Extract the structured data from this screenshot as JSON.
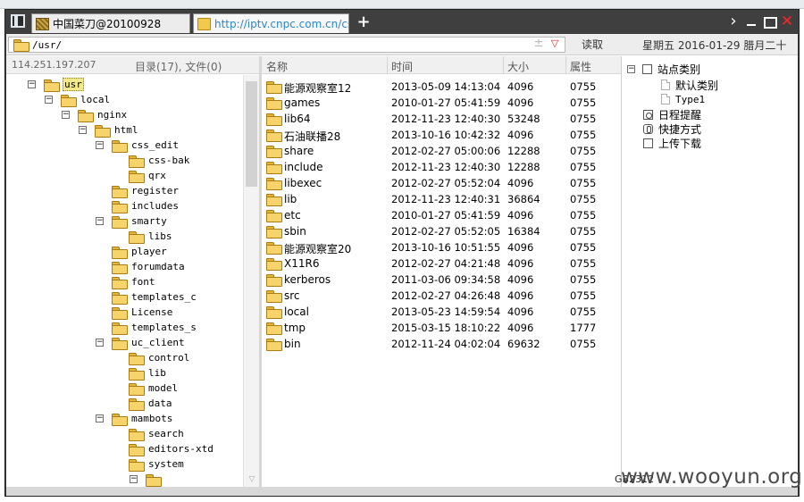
{
  "tabs": [
    {
      "label": "中国菜刀@20100928"
    },
    {
      "label": "http://iptv.cnpc.com.cn/css_..."
    }
  ],
  "icons": {
    "app": "app-layout-icon",
    "new_tab": "plus-icon",
    "next": "chevron-right-icon",
    "minimize": "minimize-icon",
    "maximize": "maximize-icon",
    "close": "close-icon"
  },
  "address": {
    "path": "/usr/",
    "read_button": "读取",
    "date": "星期五 2016-01-29 腊月二十"
  },
  "status": {
    "ip": "114.251.197.207",
    "dir_summary": "目录(17), 文件(0)"
  },
  "tree": [
    {
      "label": "usr",
      "toggle": "−",
      "selected": true
    },
    {
      "label": "local",
      "toggle": "−"
    },
    {
      "label": "nginx",
      "toggle": "−"
    },
    {
      "label": "html",
      "toggle": "−"
    },
    {
      "label": "css_edit",
      "toggle": "−"
    },
    {
      "label": "css-bak",
      "toggle": ""
    },
    {
      "label": "qrx",
      "toggle": ""
    },
    {
      "label": "register",
      "toggle": ""
    },
    {
      "label": "includes",
      "toggle": ""
    },
    {
      "label": "smarty",
      "toggle": "−"
    },
    {
      "label": "libs",
      "toggle": ""
    },
    {
      "label": "player",
      "toggle": ""
    },
    {
      "label": "forumdata",
      "toggle": ""
    },
    {
      "label": "font",
      "toggle": ""
    },
    {
      "label": "templates_c",
      "toggle": ""
    },
    {
      "label": "License",
      "toggle": ""
    },
    {
      "label": "templates_s",
      "toggle": ""
    },
    {
      "label": "uc_client",
      "toggle": "−"
    },
    {
      "label": "control",
      "toggle": ""
    },
    {
      "label": "lib",
      "toggle": ""
    },
    {
      "label": "model",
      "toggle": ""
    },
    {
      "label": "data",
      "toggle": ""
    },
    {
      "label": "mambots",
      "toggle": "−"
    },
    {
      "label": "search",
      "toggle": ""
    },
    {
      "label": "editors-xtd",
      "toggle": ""
    },
    {
      "label": "system",
      "toggle": ""
    },
    {
      "label": "",
      "toggle": "−"
    }
  ],
  "file_columns": {
    "name": "名称",
    "time": "时间",
    "size": "大小",
    "perm": "属性"
  },
  "files": [
    {
      "name": "能源观察室12",
      "time": "2013-05-09 14:13:04",
      "size": "4096",
      "perm": "0755"
    },
    {
      "name": "games",
      "time": "2010-01-27 05:41:59",
      "size": "4096",
      "perm": "0755"
    },
    {
      "name": "lib64",
      "time": "2012-11-23 12:40:30",
      "size": "53248",
      "perm": "0755"
    },
    {
      "name": "石油联播28",
      "time": "2013-10-16 10:42:32",
      "size": "4096",
      "perm": "0755"
    },
    {
      "name": "share",
      "time": "2012-02-27 05:00:06",
      "size": "12288",
      "perm": "0755"
    },
    {
      "name": "include",
      "time": "2012-11-23 12:40:30",
      "size": "12288",
      "perm": "0755"
    },
    {
      "name": "libexec",
      "time": "2012-02-27 05:52:04",
      "size": "4096",
      "perm": "0755"
    },
    {
      "name": "lib",
      "time": "2012-11-23 12:40:31",
      "size": "36864",
      "perm": "0755"
    },
    {
      "name": "etc",
      "time": "2010-01-27 05:41:59",
      "size": "4096",
      "perm": "0755"
    },
    {
      "name": "sbin",
      "time": "2012-02-27 05:52:05",
      "size": "16384",
      "perm": "0755"
    },
    {
      "name": "能源观察室20",
      "time": "2013-10-16 10:51:55",
      "size": "4096",
      "perm": "0755"
    },
    {
      "name": "X11R6",
      "time": "2012-02-27 04:21:48",
      "size": "4096",
      "perm": "0755"
    },
    {
      "name": "kerberos",
      "time": "2011-03-06 09:34:58",
      "size": "4096",
      "perm": "0755"
    },
    {
      "name": "src",
      "time": "2012-02-27 04:26:48",
      "size": "4096",
      "perm": "0755"
    },
    {
      "name": "local",
      "time": "2013-05-23 14:59:54",
      "size": "4096",
      "perm": "0755"
    },
    {
      "name": "tmp",
      "time": "2015-03-15 18:10:22",
      "size": "4096",
      "perm": "1777"
    },
    {
      "name": "bin",
      "time": "2012-11-24 04:02:04",
      "size": "69632",
      "perm": "0755"
    }
  ],
  "side_panel": [
    {
      "label": "站点类别",
      "toggle": "−",
      "icon": "checkbox-icon"
    },
    {
      "label": "默认类别",
      "toggle": "",
      "icon": "document-icon"
    },
    {
      "label": "Type1",
      "toggle": "",
      "icon": "document-icon"
    },
    {
      "label": "日程提醒",
      "toggle": "",
      "icon": "clock-icon"
    },
    {
      "label": "快捷方式",
      "toggle": "",
      "icon": "hand-icon"
    },
    {
      "label": "上传下载",
      "toggle": "",
      "icon": "checkbox-icon"
    }
  ],
  "footer": {
    "encoding": "GB2312",
    "watermark": "www.wooyun.org"
  }
}
